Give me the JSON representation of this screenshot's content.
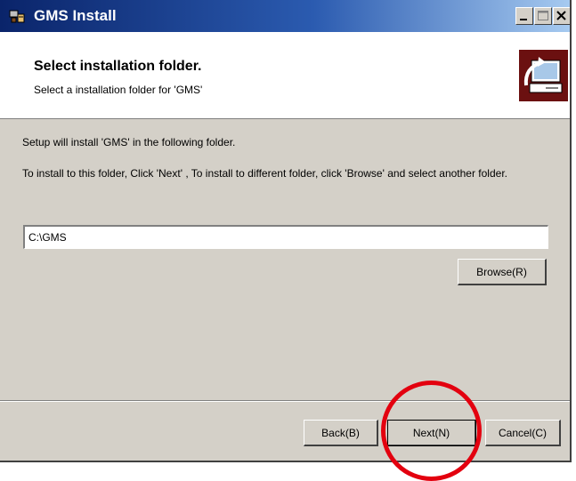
{
  "window": {
    "title": "GMS Install"
  },
  "titlebar_buttons": {
    "minimize": "minimize-icon",
    "maximize": "maximize-icon",
    "close": "close-icon"
  },
  "header": {
    "title": "Select installation folder.",
    "subtitle": "Select a installation folder for 'GMS'",
    "logo_icon": "computer-install-icon"
  },
  "content": {
    "line1": "Setup will install 'GMS' in the following folder.",
    "line2": "To install to this folder, Click 'Next' , To install to different folder, click 'Browse' and select another folder."
  },
  "folder_input": {
    "value": "C:\\GMS"
  },
  "buttons": {
    "browse": "Browse(R)",
    "back": "Back(B)",
    "next": "Next(N)",
    "cancel": "Cancel(C)"
  },
  "colors": {
    "title_gradient_start": "#0a246a",
    "title_gradient_end": "#a6caf0",
    "dialog_bg": "#d4d0c8",
    "highlight_circle": "#e3000f",
    "logo_bg": "#6b1010"
  }
}
